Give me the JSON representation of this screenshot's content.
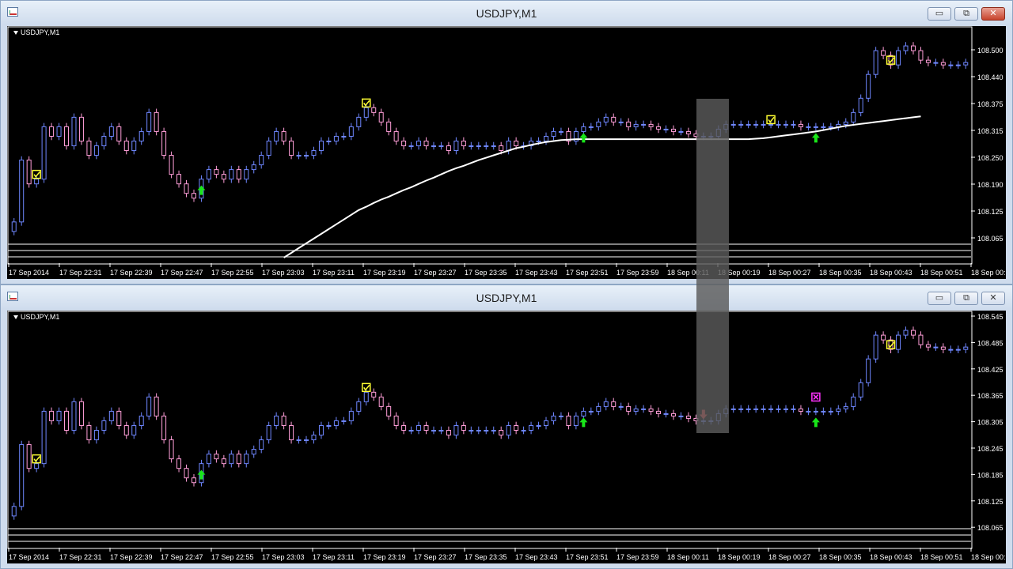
{
  "windows": [
    {
      "title": "USDJPY,M1",
      "symbol_label": "USDJPY,M1",
      "price_ticks": [
        "108.500",
        "108.440",
        "108.375",
        "108.315",
        "108.250",
        "108.190",
        "108.125",
        "108.065"
      ],
      "time_ticks": [
        "17 Sep 2014",
        "17 Sep 22:31",
        "17 Sep 22:39",
        "17 Sep 22:47",
        "17 Sep 22:55",
        "17 Sep 23:03",
        "17 Sep 23:11",
        "17 Sep 23:19",
        "17 Sep 23:27",
        "17 Sep 23:35",
        "17 Sep 23:43",
        "17 Sep 23:51",
        "17 Sep 23:59",
        "18 Sep 00:11",
        "18 Sep 00:19",
        "18 Sep 00:27",
        "18 Sep 00:35",
        "18 Sep 00:43",
        "18 Sep 00:51",
        "18 Sep 00:"
      ]
    },
    {
      "title": "USDJPY,M1",
      "symbol_label": "USDJPY,M1",
      "price_ticks": [
        "108.545",
        "108.485",
        "108.425",
        "108.365",
        "108.305",
        "108.245",
        "108.185",
        "108.125",
        "108.065"
      ],
      "time_ticks": [
        "17 Sep 2014",
        "17 Sep 22:31",
        "17 Sep 22:39",
        "17 Sep 22:47",
        "17 Sep 22:55",
        "17 Sep 23:03",
        "17 Sep 23:11",
        "17 Sep 23:19",
        "17 Sep 23:27",
        "17 Sep 23:35",
        "17 Sep 23:43",
        "17 Sep 23:51",
        "17 Sep 23:59",
        "18 Sep 00:11",
        "18 Sep 00:19",
        "18 Sep 00:27",
        "18 Sep 00:35",
        "18 Sep 00:43",
        "18 Sep 00:51",
        "18 Sep 00:"
      ]
    }
  ],
  "window_buttons": {
    "minimize": "▭",
    "restore": "⧉",
    "close": "✕"
  },
  "colors": {
    "bull": "#6f87ff",
    "bear": "#ff9ed8",
    "ma": "#ffffff",
    "signal_up": "#19e619",
    "signal_down": "#ff4d4d",
    "check": "#ffff33",
    "cross": "#ff33ff",
    "highlight": "#555555"
  },
  "chart_data": [
    {
      "type": "candlestick",
      "title": "USDJPY,M1",
      "ylim": [
        108.06,
        108.545
      ],
      "closes": [
        108.14,
        108.27,
        108.22,
        108.23,
        108.34,
        108.32,
        108.34,
        108.3,
        108.36,
        108.31,
        108.28,
        108.3,
        108.32,
        108.34,
        108.31,
        108.29,
        108.31,
        108.33,
        108.37,
        108.33,
        108.28,
        108.24,
        108.22,
        108.2,
        108.19,
        108.23,
        108.25,
        108.24,
        108.23,
        108.25,
        108.23,
        108.25,
        108.26,
        108.28,
        108.31,
        108.33,
        108.31,
        108.28,
        108.28,
        108.28,
        108.29,
        108.31,
        108.31,
        108.32,
        108.32,
        108.34,
        108.36,
        108.38,
        108.37,
        108.35,
        108.33,
        108.31,
        108.3,
        108.3,
        108.31,
        108.3,
        108.3,
        108.3,
        108.29,
        108.31,
        108.3,
        108.3,
        108.3,
        108.3,
        108.3,
        108.29,
        108.31,
        108.3,
        108.3,
        108.31,
        108.31,
        108.32,
        108.33,
        108.33,
        108.31,
        108.33,
        108.34,
        108.34,
        108.35,
        108.36,
        108.35,
        108.35,
        108.34,
        108.345,
        108.345,
        108.34,
        108.335,
        108.335,
        108.33,
        108.33,
        108.325,
        108.32,
        108.32,
        108.32,
        108.335,
        108.345,
        108.345,
        108.345,
        108.345,
        108.345,
        108.345,
        108.345,
        108.345,
        108.345,
        108.345,
        108.34,
        108.34,
        108.34,
        108.34,
        108.34,
        108.345,
        108.35,
        108.37,
        108.4,
        108.45,
        108.5,
        108.49,
        108.47,
        108.5,
        108.51,
        108.5,
        108.48,
        108.475,
        108.475,
        108.47,
        108.47,
        108.47,
        108.475
      ],
      "ma_y": [
        null,
        null,
        null,
        null,
        null,
        null,
        null,
        null,
        null,
        null,
        null,
        null,
        null,
        null,
        null,
        null,
        null,
        null,
        null,
        null,
        null,
        null,
        null,
        null,
        null,
        null,
        null,
        null,
        null,
        null,
        null,
        null,
        null,
        null,
        null,
        null,
        108.065,
        108.075,
        108.085,
        108.095,
        108.105,
        108.115,
        108.125,
        108.135,
        108.145,
        108.155,
        108.165,
        108.172,
        108.18,
        108.187,
        108.193,
        108.2,
        108.207,
        108.213,
        108.22,
        108.227,
        108.233,
        108.24,
        108.247,
        108.253,
        108.258,
        108.264,
        108.27,
        108.275,
        108.28,
        108.285,
        108.29,
        108.295,
        108.298,
        108.302,
        108.305,
        108.308,
        108.31,
        108.312,
        108.313,
        108.314,
        108.314,
        108.314,
        108.314,
        108.314,
        108.314,
        108.314,
        108.314,
        108.314,
        108.314,
        108.314,
        108.314,
        108.314,
        108.314,
        108.314,
        108.314,
        108.314,
        108.314,
        108.314,
        108.314,
        108.314,
        108.314,
        108.314,
        108.314,
        108.315,
        108.316,
        108.318,
        108.32,
        108.322,
        108.324,
        108.326,
        108.328,
        108.33,
        108.333,
        108.336,
        108.339,
        108.342,
        108.344,
        108.346,
        108.348,
        108.35,
        108.352,
        108.354,
        108.356,
        108.358,
        108.36,
        108.362
      ]
    },
    {
      "type": "candlestick",
      "title": "USDJPY,M1",
      "ylim": [
        108.06,
        108.545
      ],
      "closes": [
        108.14,
        108.27,
        108.22,
        108.23,
        108.34,
        108.32,
        108.34,
        108.3,
        108.36,
        108.31,
        108.28,
        108.3,
        108.32,
        108.34,
        108.31,
        108.29,
        108.31,
        108.33,
        108.37,
        108.33,
        108.28,
        108.24,
        108.22,
        108.2,
        108.19,
        108.23,
        108.25,
        108.24,
        108.23,
        108.25,
        108.23,
        108.25,
        108.26,
        108.28,
        108.31,
        108.33,
        108.31,
        108.28,
        108.28,
        108.28,
        108.29,
        108.31,
        108.31,
        108.32,
        108.32,
        108.34,
        108.36,
        108.38,
        108.37,
        108.35,
        108.33,
        108.31,
        108.3,
        108.3,
        108.31,
        108.3,
        108.3,
        108.3,
        108.29,
        108.31,
        108.3,
        108.3,
        108.3,
        108.3,
        108.3,
        108.29,
        108.31,
        108.3,
        108.3,
        108.31,
        108.31,
        108.32,
        108.33,
        108.33,
        108.31,
        108.33,
        108.34,
        108.34,
        108.35,
        108.36,
        108.35,
        108.35,
        108.34,
        108.345,
        108.345,
        108.34,
        108.335,
        108.335,
        108.33,
        108.33,
        108.325,
        108.32,
        108.32,
        108.32,
        108.335,
        108.345,
        108.345,
        108.345,
        108.345,
        108.345,
        108.345,
        108.345,
        108.345,
        108.345,
        108.345,
        108.34,
        108.34,
        108.34,
        108.34,
        108.34,
        108.345,
        108.35,
        108.37,
        108.4,
        108.45,
        108.5,
        108.49,
        108.47,
        108.5,
        108.51,
        108.5,
        108.48,
        108.475,
        108.475,
        108.47,
        108.47,
        108.47,
        108.475
      ]
    }
  ]
}
